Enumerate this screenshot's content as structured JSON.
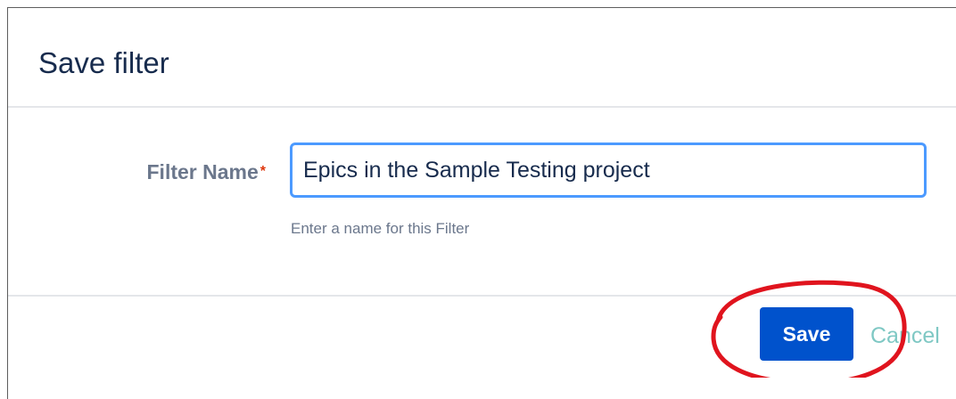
{
  "dialog": {
    "title": "Save filter"
  },
  "form": {
    "filter_name_label": "Filter Name",
    "required_marker": "*",
    "filter_name_value": "Epics in the Sample Testing project",
    "help_text": "Enter a name for this Filter"
  },
  "footer": {
    "save_label": "Save",
    "cancel_label": "Cancel"
  },
  "colors": {
    "primary_button": "#0052cc",
    "focus_border": "#4c9aff",
    "annotation": "#e0141e",
    "required": "#de350b"
  }
}
